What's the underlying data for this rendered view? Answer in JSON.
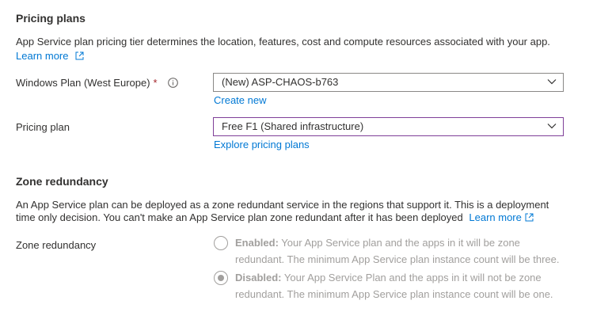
{
  "pricing": {
    "title": "Pricing plans",
    "description": "App Service plan pricing tier determines the location, features, cost and compute resources associated with your app.",
    "learn_more": "Learn more",
    "windows_plan_label": "Windows Plan (West Europe)",
    "required_marker": "*",
    "windows_plan_value": "(New) ASP-CHAOS-b763",
    "create_new": "Create new",
    "pricing_plan_label": "Pricing plan",
    "pricing_plan_value": "Free F1 (Shared infrastructure)",
    "explore": "Explore pricing plans"
  },
  "zone": {
    "title": "Zone redundancy",
    "description_line1": "An App Service plan can be deployed as a zone redundant service in the regions that support it. This is a deployment",
    "description_line2": "time only decision. You can't make an App Service plan zone redundant after it has been deployed",
    "learn_more": "Learn more",
    "label": "Zone redundancy",
    "enabled_bold": "Enabled:",
    "enabled_line1": "Your App Service plan and the apps in it will be zone",
    "enabled_line2": "redundant. The minimum App Service plan instance count will be three.",
    "disabled_bold": "Disabled:",
    "disabled_line1": "Your App Service Plan and the apps in it will not be zone",
    "disabled_line2": "redundant. The minimum App Service plan instance count will be one.",
    "selected": "disabled"
  },
  "colors": {
    "link": "#0078d4",
    "required": "#a4262c",
    "focus_border": "#7f3f98"
  },
  "icons": {
    "external": "external-link-icon",
    "info": "info-icon",
    "chevron": "chevron-down-icon"
  }
}
